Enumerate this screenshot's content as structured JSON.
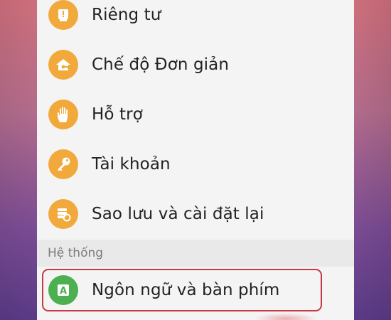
{
  "items": [
    {
      "label": "Riêng tư",
      "icon": "privacy-icon",
      "color": "#f2a93b"
    },
    {
      "label": "Chế độ Đơn giản",
      "icon": "easy-mode-icon",
      "color": "#f2a93b"
    },
    {
      "label": "Hỗ trợ",
      "icon": "accessibility-hand-icon",
      "color": "#f2a93b"
    },
    {
      "label": "Tài khoản",
      "icon": "key-icon",
      "color": "#f2a93b"
    },
    {
      "label": "Sao lưu và cài đặt lại",
      "icon": "backup-icon",
      "color": "#f2a93b"
    }
  ],
  "section": {
    "title": "Hệ thống"
  },
  "system_items": [
    {
      "label": "Ngôn ngữ và bàn phím",
      "icon": "language-icon",
      "icon_letter": "A",
      "color": "#4caf50"
    }
  ],
  "colors": {
    "highlight_border": "#c73a45",
    "panel_background": "#f4f4f4",
    "section_background": "#e9e9e9"
  }
}
